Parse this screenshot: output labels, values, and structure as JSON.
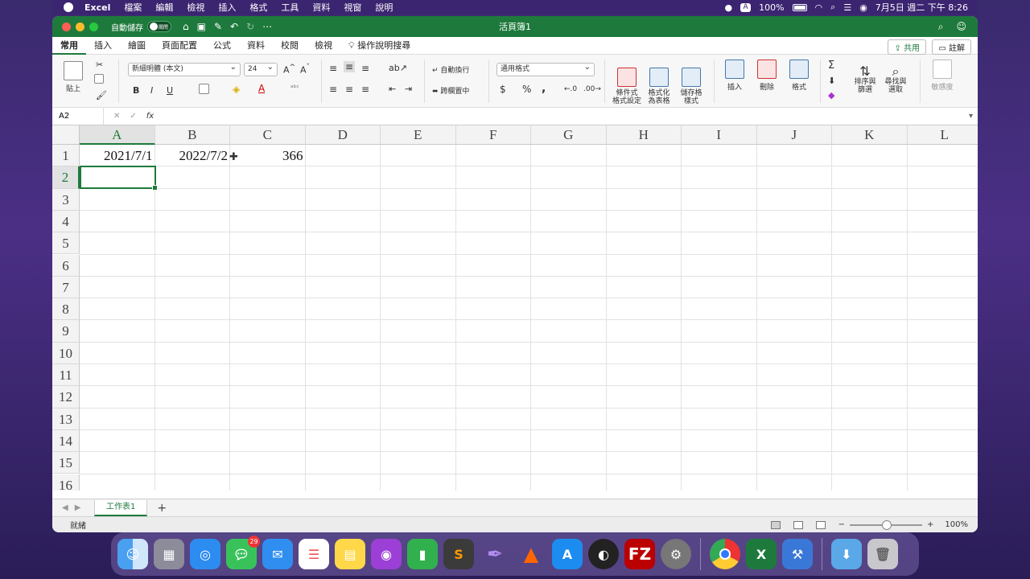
{
  "menubar": {
    "app_name": "Excel",
    "items": [
      "檔案",
      "編輯",
      "檢視",
      "插入",
      "格式",
      "工具",
      "資料",
      "視窗",
      "說明"
    ],
    "battery": "100%",
    "datetime": "7月5日 週二 下午 8:26",
    "input_source": "A"
  },
  "window": {
    "title": "活頁簿1",
    "autosave_label": "自動儲存",
    "autosave_state": "關閉"
  },
  "ribbon_tabs": {
    "tabs": [
      "常用",
      "插入",
      "繪圖",
      "頁面配置",
      "公式",
      "資料",
      "校閱",
      "檢視"
    ],
    "tell_me": "操作說明搜尋",
    "share_label": "共用",
    "comments_label": "註解"
  },
  "ribbon": {
    "paste_label": "貼上",
    "font_name": "新細明體 (本文)",
    "font_size": "24",
    "bold": "B",
    "italic": "I",
    "underline": "U",
    "wrap_text": "自動換行",
    "merge_center": "跨欄置中",
    "number_format": "通用格式",
    "currency": "$",
    "percent": "%",
    "comma": ",",
    "conditional_format": "條件式\n格式設定",
    "format_as_table": "格式化\n為表格",
    "cell_styles": "儲存格\n樣式",
    "insert": "插入",
    "delete": "刪除",
    "format": "格式",
    "sort_filter": "排序與\n篩選",
    "find_select": "尋找與\n選取",
    "sensitivity": "敏感度"
  },
  "formula_bar": {
    "name_box": "A2",
    "fx": "fx",
    "formula": ""
  },
  "grid": {
    "columns": [
      "A",
      "B",
      "C",
      "D",
      "E",
      "F",
      "G",
      "H",
      "I",
      "J",
      "K",
      "L"
    ],
    "rows": [
      "1",
      "2",
      "3",
      "4",
      "5",
      "6",
      "7",
      "8",
      "9",
      "10",
      "11",
      "12",
      "13",
      "14",
      "15",
      "16"
    ],
    "cells": {
      "A1": "2021/7/1",
      "B1": "2022/7/2",
      "C1": "366"
    },
    "active_cell": "A2"
  },
  "sheets": {
    "tabs": [
      "工作表1"
    ],
    "add": "+"
  },
  "status": {
    "ready": "就緒",
    "zoom": "100%"
  },
  "dock": {
    "messages_badge": "29",
    "apps": [
      "finder-icon",
      "launchpad-icon",
      "safari-icon",
      "messages-icon",
      "mail-icon",
      "reminders-icon",
      "notes-icon",
      "podcasts-icon",
      "numbers-icon",
      "sublime-icon",
      "quill-icon",
      "vlc-icon",
      "app-store-icon",
      "obs-icon",
      "filezilla-icon",
      "system-preferences-icon",
      "chrome-icon",
      "excel-icon",
      "xcode-icon",
      "downloads-icon",
      "trash-icon"
    ]
  }
}
